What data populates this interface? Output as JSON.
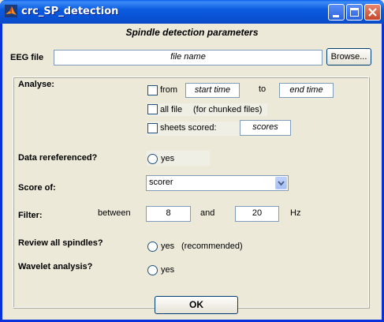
{
  "window": {
    "title": "crc_SP_detection"
  },
  "header": {
    "title": "Spindle detection parameters"
  },
  "eeg": {
    "label": "EEG file",
    "value": "file name",
    "browse_label": "Browse..."
  },
  "analyse": {
    "label": "Analyse:",
    "from_label": "from",
    "start_time": "start time",
    "to_label": "to",
    "end_time": "end time",
    "all_file_label": "all file",
    "all_file_note": "(for chunked files)",
    "sheets_label": "sheets scored:",
    "scores": "scores"
  },
  "rereferenced": {
    "label": "Data rereferenced?",
    "option": "yes"
  },
  "score_of": {
    "label": "Score of:",
    "selected": "scorer"
  },
  "filter": {
    "label": "Filter:",
    "between_label": "between",
    "low": "8",
    "and_label": "and",
    "high": "20",
    "unit": "Hz"
  },
  "review": {
    "label": "Review all spindles?",
    "option": "yes",
    "note": "(recommended)"
  },
  "wavelet": {
    "label": "Wavelet analysis?",
    "option": "yes"
  },
  "ok_label": "OK",
  "colors": {
    "titlebar": "#0a53d6",
    "face": "#ece9d8",
    "field_border": "#7f9db9",
    "close_button": "#c6452a"
  }
}
